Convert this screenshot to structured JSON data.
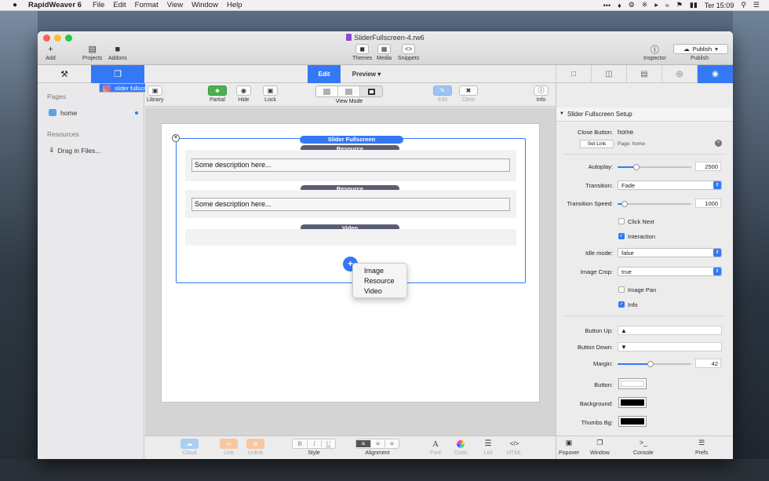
{
  "menubar": {
    "apple": "",
    "app_name": "RapidWeaver 6",
    "items": [
      "File",
      "Edit",
      "Format",
      "View",
      "Window",
      "Help"
    ],
    "clock": "Ter 15:09"
  },
  "window": {
    "title": "SliderFullscreen-4.rw6",
    "toolbar": {
      "add": "Add",
      "projects": "Projects",
      "addons": "Addons",
      "themes": "Themes",
      "media": "Media",
      "snippets": "Snippets",
      "inspector": "Inspector",
      "publish_button": "Publish",
      "publish": "Publish"
    }
  },
  "tabs": {
    "edit": "Edit",
    "preview": "Preview"
  },
  "sidebar": {
    "pages_header": "Pages",
    "pages": [
      {
        "label": "home"
      },
      {
        "label": "slider fullscreen"
      }
    ],
    "resources_header": "Resources",
    "drag_files": "Drag in Files..."
  },
  "editor_toolbar": {
    "library": "Library",
    "partial": "Partial",
    "hide": "Hide",
    "lock": "Lock",
    "view_mode": "View Mode",
    "edit": "Edit",
    "clear": "Clear",
    "info": "Info"
  },
  "canvas": {
    "stack_title": "Slider Fullscreen",
    "slides": [
      {
        "label": "Resource",
        "description": "Some description here..."
      },
      {
        "label": "Resource",
        "description": "Some description here..."
      },
      {
        "label": "Video",
        "description": ""
      }
    ],
    "add_menu": [
      "Image",
      "Resource",
      "Video"
    ]
  },
  "bottom_bar": {
    "cloud": "Cloud",
    "link": "Link",
    "unlink": "Unlink",
    "bold": "B",
    "italic": "I",
    "underline": "U",
    "style": "Style",
    "alignment": "Alignment",
    "font": "Font",
    "font_glyph": "A",
    "color": "Color",
    "list": "List",
    "html": "HTML",
    "html_glyph": "</>"
  },
  "inspector": {
    "section_title": "Slider Fullscreen Setup",
    "close_button_label": "Close Button:",
    "close_button_value": "home",
    "set_link": "Set Link",
    "page_link": "Page: home",
    "autoplay_label": "Autoplay:",
    "autoplay_value": "2500",
    "autoplay_fraction": 0.25,
    "transition_label": "Transition:",
    "transition_value": "Fade",
    "transition_speed_label": "Transition Speed:",
    "transition_speed_value": "1000",
    "transition_speed_fraction": 0.1,
    "click_next": "Click Next",
    "click_next_checked": false,
    "interaction": "Interaction",
    "interaction_checked": true,
    "idle_mode_label": "Idle mode:",
    "idle_mode_value": "false",
    "image_crop_label": "Image Crop:",
    "image_crop_value": "true",
    "image_pan": "Image Pan",
    "image_pan_checked": false,
    "info": "Info",
    "info_checked": true,
    "button_up_label": "Button Up:",
    "button_up_value": "▲",
    "button_down_label": "Button Down:",
    "button_down_value": "▼",
    "margin_label": "Margin:",
    "margin_value": "42",
    "margin_fraction": 0.45,
    "button_label": "Button:",
    "button_color": "#ffffff",
    "background_label": "Background:",
    "background_color": "#000000",
    "thumbs_bg_label": "Thumbs Bg:",
    "thumbs_bg_color": "#000000",
    "bottom": {
      "popover": "Popover",
      "window": "Window",
      "console": "Console",
      "prefs": "Prefs"
    }
  },
  "colors": {
    "accent": "#3478f6",
    "slide_label": "#5a5d73",
    "partial_green": "#4caf50"
  }
}
